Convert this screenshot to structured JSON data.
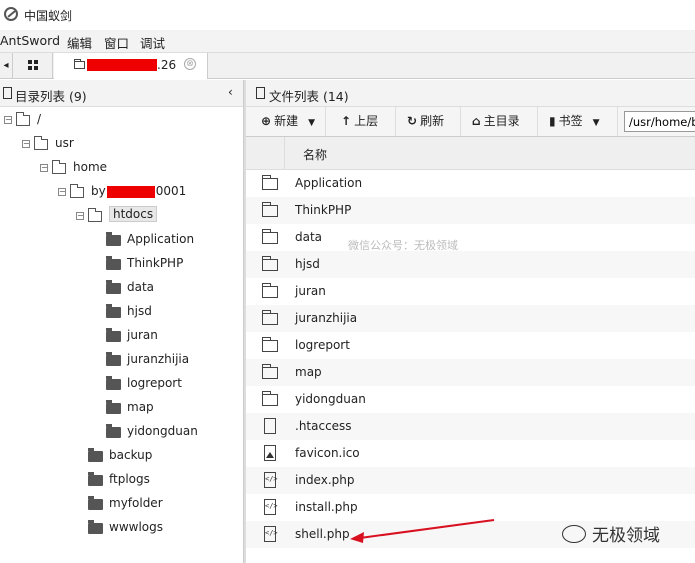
{
  "window": {
    "title": "中国蚁剑"
  },
  "menu": [
    "AntSword",
    "编辑",
    "窗口",
    "调试"
  ],
  "tabs": {
    "active_suffix": ".26",
    "close_symbol": "⊗"
  },
  "left_panel": {
    "header": "目录列表 (9)",
    "collapse_symbol": "‹",
    "tree": [
      {
        "label": "/",
        "depth": 0,
        "type": "open"
      },
      {
        "label": "usr",
        "depth": 1,
        "type": "open"
      },
      {
        "label": "home",
        "depth": 2,
        "type": "open"
      },
      {
        "label_prefix": "by",
        "label_suffix": "0001",
        "depth": 3,
        "type": "open"
      },
      {
        "label": "htdocs",
        "depth": 4,
        "type": "open",
        "selected": true
      },
      {
        "label": "Application",
        "depth": 5,
        "type": "filled"
      },
      {
        "label": "ThinkPHP",
        "depth": 5,
        "type": "filled"
      },
      {
        "label": "data",
        "depth": 5,
        "type": "filled"
      },
      {
        "label": "hjsd",
        "depth": 5,
        "type": "filled"
      },
      {
        "label": "juran",
        "depth": 5,
        "type": "filled"
      },
      {
        "label": "juranzhijia",
        "depth": 5,
        "type": "filled"
      },
      {
        "label": "logreport",
        "depth": 5,
        "type": "filled"
      },
      {
        "label": "map",
        "depth": 5,
        "type": "filled"
      },
      {
        "label": "yidongduan",
        "depth": 5,
        "type": "filled"
      },
      {
        "label": "backup",
        "depth": 4,
        "type": "filled"
      },
      {
        "label": "ftplogs",
        "depth": 4,
        "type": "filled"
      },
      {
        "label": "myfolder",
        "depth": 4,
        "type": "filled"
      },
      {
        "label": "wwwlogs",
        "depth": 4,
        "type": "filled"
      }
    ]
  },
  "right_panel": {
    "header": "文件列表 (14)",
    "toolbar": {
      "new": "新建",
      "up": "上层",
      "refresh": "刷新",
      "home": "主目录",
      "bookmark": "书签",
      "path": "/usr/home/by"
    },
    "column_name": "名称",
    "files": [
      {
        "name": "Application",
        "icon": "folder-icon"
      },
      {
        "name": "ThinkPHP",
        "icon": "folder-icon"
      },
      {
        "name": "data",
        "icon": "folder-icon"
      },
      {
        "name": "hjsd",
        "icon": "folder-icon"
      },
      {
        "name": "juran",
        "icon": "folder-icon"
      },
      {
        "name": "juranzhijia",
        "icon": "folder-icon"
      },
      {
        "name": "logreport",
        "icon": "folder-icon"
      },
      {
        "name": "map",
        "icon": "folder-icon"
      },
      {
        "name": "yidongduan",
        "icon": "folder-icon"
      },
      {
        "name": ".htaccess",
        "icon": "file-icon"
      },
      {
        "name": "favicon.ico",
        "icon": "image-file-icon"
      },
      {
        "name": "index.php",
        "icon": "code-file-icon"
      },
      {
        "name": "install.php",
        "icon": "code-file-icon"
      },
      {
        "name": "shell.php",
        "icon": "code-file-icon"
      }
    ]
  },
  "watermarks": {
    "center": "微信公众号：无极领域",
    "corner": "无极领域"
  },
  "colors": {
    "redaction": "#e00000",
    "arrow": "#d81020"
  }
}
